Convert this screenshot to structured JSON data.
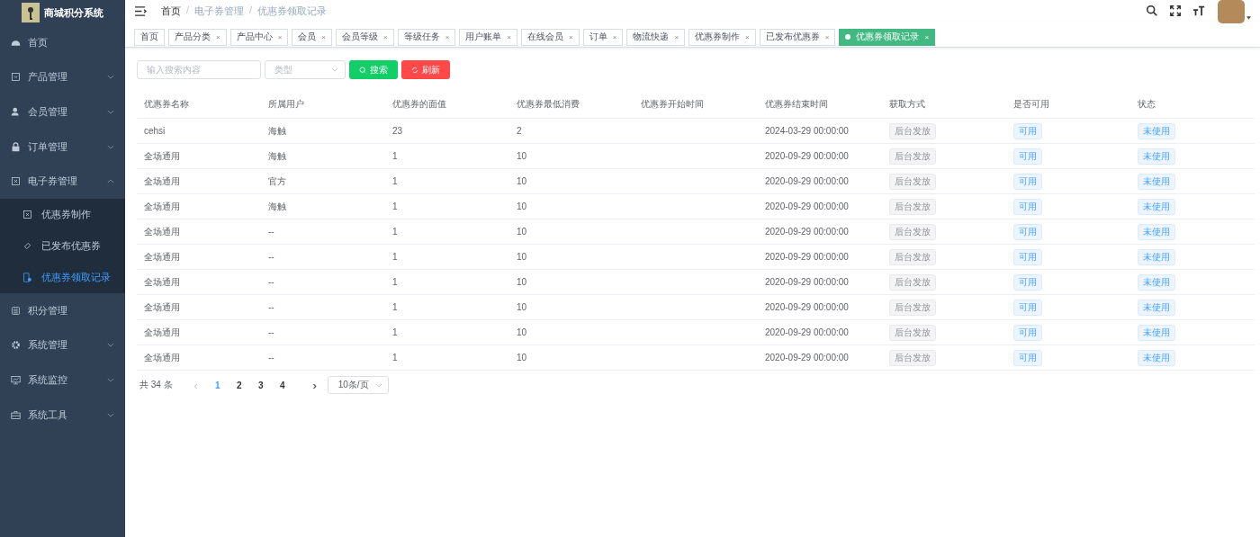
{
  "logo": {
    "title": "商城积分系统"
  },
  "sidebar": {
    "items": [
      {
        "label": "首页"
      },
      {
        "label": "产品管理",
        "expanded": false
      },
      {
        "label": "会员管理",
        "expanded": false
      },
      {
        "label": "订单管理",
        "expanded": false
      },
      {
        "label": "电子券管理",
        "expanded": true,
        "children": [
          {
            "label": "优惠券制作",
            "selected": false
          },
          {
            "label": "已发布优惠券",
            "selected": false
          },
          {
            "label": "优惠券领取记录",
            "selected": true
          }
        ]
      },
      {
        "label": "积分管理"
      },
      {
        "label": "系统管理",
        "expanded": false
      },
      {
        "label": "系统监控",
        "expanded": false
      },
      {
        "label": "系统工具",
        "expanded": false
      }
    ]
  },
  "breadcrumb": {
    "separator": "/",
    "items": [
      "首页",
      "电子券管理",
      "优惠券领取记录"
    ]
  },
  "tags": [
    {
      "label": "首页",
      "selected": false
    },
    {
      "label": "产品分类",
      "selected": false,
      "close": "×"
    },
    {
      "label": "产品中心",
      "selected": false,
      "close": "×"
    },
    {
      "label": "会员",
      "selected": false,
      "close": "×"
    },
    {
      "label": "会员等级",
      "selected": false,
      "close": "×"
    },
    {
      "label": "等级任务",
      "selected": false,
      "close": "×"
    },
    {
      "label": "用户账单",
      "selected": false,
      "close": "×"
    },
    {
      "label": "在线会员",
      "selected": false,
      "close": "×"
    },
    {
      "label": "订单",
      "selected": false,
      "close": "×"
    },
    {
      "label": "物流快递",
      "selected": false,
      "close": "×"
    },
    {
      "label": "优惠券制作",
      "selected": false,
      "close": "×"
    },
    {
      "label": "已发布优惠券",
      "selected": false,
      "close": "×"
    },
    {
      "label": "优惠券领取记录",
      "selected": true,
      "close": "×"
    }
  ],
  "filters": {
    "search_placeholder": "输入搜索内容",
    "type_placeholder": "类型",
    "search_button": "搜索",
    "refresh_button": "刷新"
  },
  "table": {
    "columns": [
      "优惠券名称",
      "所属用户",
      "优惠券的面值",
      "优惠券最低消费",
      "优惠券开始时间",
      "优惠券结束时间",
      "获取方式",
      "是否可用",
      "状态"
    ],
    "rows": [
      {
        "name": "cehsi",
        "user": "海触",
        "value": "23",
        "min_spend": "2",
        "end_time": "2024-03-29 00:00:00",
        "method": "后台发放",
        "usable": "可用",
        "status": "未使用"
      },
      {
        "name": "全场通用",
        "user": "海触",
        "value": "1",
        "min_spend": "10",
        "end_time": "2020-09-29 00:00:00",
        "method": "后台发放",
        "usable": "可用",
        "status": "未使用"
      },
      {
        "name": "全场通用",
        "user": "官方",
        "value": "1",
        "min_spend": "10",
        "end_time": "2020-09-29 00:00:00",
        "method": "后台发放",
        "usable": "可用",
        "status": "未使用"
      },
      {
        "name": "全场通用",
        "user": "海触",
        "value": "1",
        "min_spend": "10",
        "end_time": "2020-09-29 00:00:00",
        "method": "后台发放",
        "usable": "可用",
        "status": "未使用"
      },
      {
        "name": "全场通用",
        "user": "--",
        "value": "1",
        "min_spend": "10",
        "end_time": "2020-09-29 00:00:00",
        "method": "后台发放",
        "usable": "可用",
        "status": "未使用"
      },
      {
        "name": "全场通用",
        "user": "--",
        "value": "1",
        "min_spend": "10",
        "end_time": "2020-09-29 00:00:00",
        "method": "后台发放",
        "usable": "可用",
        "status": "未使用"
      },
      {
        "name": "全场通用",
        "user": "--",
        "value": "1",
        "min_spend": "10",
        "end_time": "2020-09-29 00:00:00",
        "method": "后台发放",
        "usable": "可用",
        "status": "未使用"
      },
      {
        "name": "全场通用",
        "user": "--",
        "value": "1",
        "min_spend": "10",
        "end_time": "2020-09-29 00:00:00",
        "method": "后台发放",
        "usable": "可用",
        "status": "未使用"
      },
      {
        "name": "全场通用",
        "user": "--",
        "value": "1",
        "min_spend": "10",
        "end_time": "2020-09-29 00:00:00",
        "method": "后台发放",
        "usable": "可用",
        "status": "未使用"
      },
      {
        "name": "全场通用",
        "user": "--",
        "value": "1",
        "min_spend": "10",
        "end_time": "2020-09-29 00:00:00",
        "method": "后台发放",
        "usable": "可用",
        "status": "未使用"
      }
    ]
  },
  "pagination": {
    "total": "共 34 条",
    "prev": "‹",
    "next": "›",
    "pages": [
      {
        "label": "1",
        "selected": true
      },
      {
        "label": "2",
        "selected": false
      },
      {
        "label": "3",
        "selected": false
      },
      {
        "label": "4",
        "selected": false
      }
    ],
    "page_size": "10条/页"
  }
}
